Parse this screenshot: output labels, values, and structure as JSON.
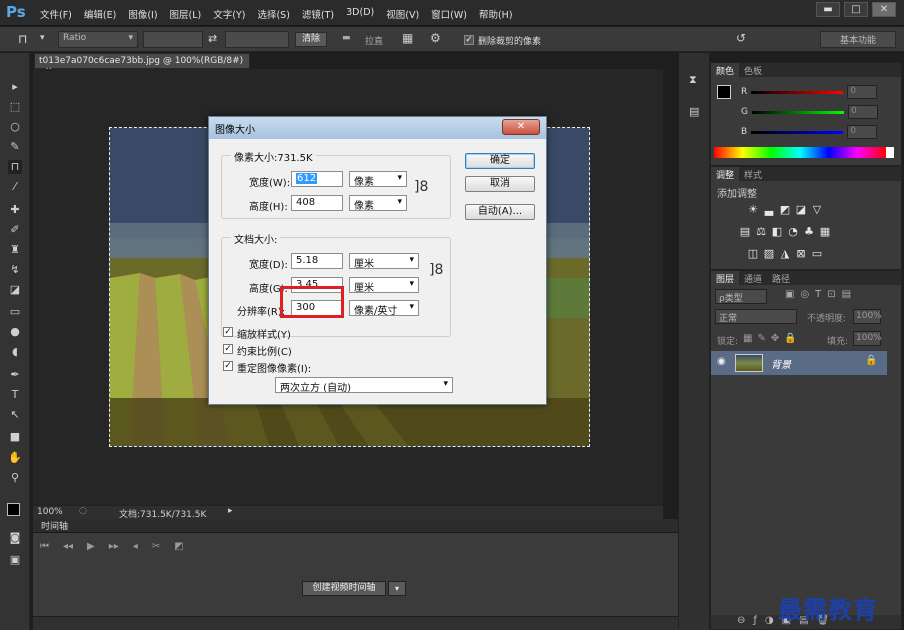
{
  "app": {
    "logo": "Ps"
  },
  "menu": [
    "文件(F)",
    "编辑(E)",
    "图像(I)",
    "图层(L)",
    "文字(Y)",
    "选择(S)",
    "滤镜(T)",
    "3D(D)",
    "视图(V)",
    "窗口(W)",
    "帮助(H)"
  ],
  "window_controls": {
    "minimize": "▬",
    "maximize": "□",
    "close": "✕"
  },
  "options": {
    "ratio_label": "Ratio",
    "clear_button": "清除",
    "straighten_label": "拉直",
    "delete_cropped_label": "删除裁剪的像素",
    "workspace": "基本功能"
  },
  "document": {
    "tab_title": "t013e7a070c6cae73bb.jpg @ 100%(RGB/8#)",
    "tab_close": "×",
    "zoom": "100%",
    "doc_size": "文档:731.5K/731.5K"
  },
  "timeline": {
    "title": "时间轴",
    "create_button": "创建视频时间轴"
  },
  "panels": {
    "color": {
      "tabs": [
        "颜色",
        "色板"
      ],
      "r_label": "R",
      "g_label": "G",
      "b_label": "B",
      "r_value": "0",
      "g_value": "0",
      "b_value": "0"
    },
    "adjust": {
      "tabs": [
        "调整",
        "样式"
      ],
      "title": "添加调整"
    },
    "layers": {
      "tabs": [
        "图层",
        "通道",
        "路径"
      ],
      "filter_label": "ρ类型",
      "blend_mode": "正常",
      "opacity_label": "不透明度:",
      "opacity_value": "100%",
      "lock_label": "锁定:",
      "fill_label": "填充:",
      "fill_value": "100%",
      "layer_name": "背景"
    }
  },
  "dialog": {
    "title": "图像大小",
    "close": "✕",
    "pixel_group_label": "像素大小:731.5K",
    "width_label": "宽度(W):",
    "width_value": "612",
    "width_unit": "像素",
    "height_label": "高度(H):",
    "height_value": "408",
    "height_unit": "像素",
    "doc_group_label": "文档大小:",
    "doc_width_label": "宽度(D):",
    "doc_width_value": "5.18",
    "doc_width_unit": "厘米",
    "doc_height_label": "高度(G):",
    "doc_height_value": "3.45",
    "doc_height_unit": "厘米",
    "resolution_label": "分辨率(R):",
    "resolution_value": "300",
    "resolution_unit": "像素/英寸",
    "scale_styles_label": "缩放样式(Y)",
    "constrain_label": "约束比例(C)",
    "resample_label": "重定图像像素(I):",
    "resample_method": "两次立方 (自动)",
    "ok_button": "确定",
    "cancel_button": "取消",
    "auto_button": "自动(A)..."
  },
  "watermark": "最需教育",
  "colors": {
    "highlight": "#e02020",
    "dialog_bg": "#f0f0f0",
    "panel_bg": "#3a3a3a",
    "accent": "#5aa9e6"
  }
}
